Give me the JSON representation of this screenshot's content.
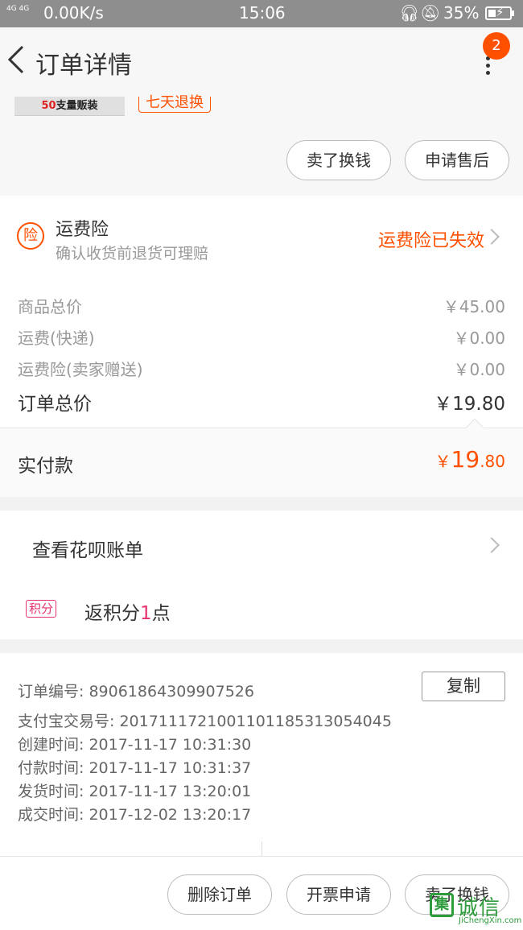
{
  "status_bar": {
    "signal": "4G 4G",
    "net_speed": "0.00K/s",
    "time": "15:06",
    "icons": [
      "headset-icon",
      "mute-bell-icon"
    ],
    "battery": "35%",
    "battery_level": 0.35
  },
  "header": {
    "title": "订单详情",
    "badge_count": "2"
  },
  "product": {
    "image_text_red": "50",
    "image_text": "支量贩装",
    "service_tag": "七天退换",
    "buttons": [
      "卖了换钱",
      "申请售后"
    ]
  },
  "insurance": {
    "icon_char": "险",
    "title": "运费险",
    "subtitle": "确认收货前退货可理赔",
    "status": "运费险已失效"
  },
  "price": {
    "rows": [
      {
        "label": "商品总价",
        "value": "￥45.00"
      },
      {
        "label": "运费(快递)",
        "value": "￥0.00"
      },
      {
        "label": "运费险(卖家赠送)",
        "value": "￥0.00"
      }
    ],
    "total_label": "订单总价",
    "total_value": "￥19.80",
    "paid_label": "实付款",
    "paid_currency": "￥",
    "paid_int": "19",
    "paid_dec": ".80"
  },
  "huabei": {
    "label": "查看花呗账单",
    "points_tag": "积分",
    "points_prefix": "返积分",
    "points_num": "1",
    "points_suffix": "点"
  },
  "order_info": {
    "copy_label": "复制",
    "rows": [
      {
        "label": "订单编号:",
        "value": "89061864309907526"
      },
      {
        "label": "支付宝交易号:",
        "value": "2017111721001101185313054045"
      },
      {
        "label": "创建时间:",
        "value": "2017-11-17 10:31:30"
      },
      {
        "label": "付款时间:",
        "value": "2017-11-17 10:31:37"
      },
      {
        "label": "发货时间:",
        "value": "2017-11-17 13:20:01"
      },
      {
        "label": "成交时间:",
        "value": "2017-12-02 13:20:17"
      }
    ]
  },
  "bottom_bar": {
    "buttons": [
      "删除订单",
      "开票申请",
      "卖了换钱"
    ]
  },
  "watermark": {
    "box": "集",
    "cn": "诚信",
    "en": "JiChengXin.com"
  }
}
